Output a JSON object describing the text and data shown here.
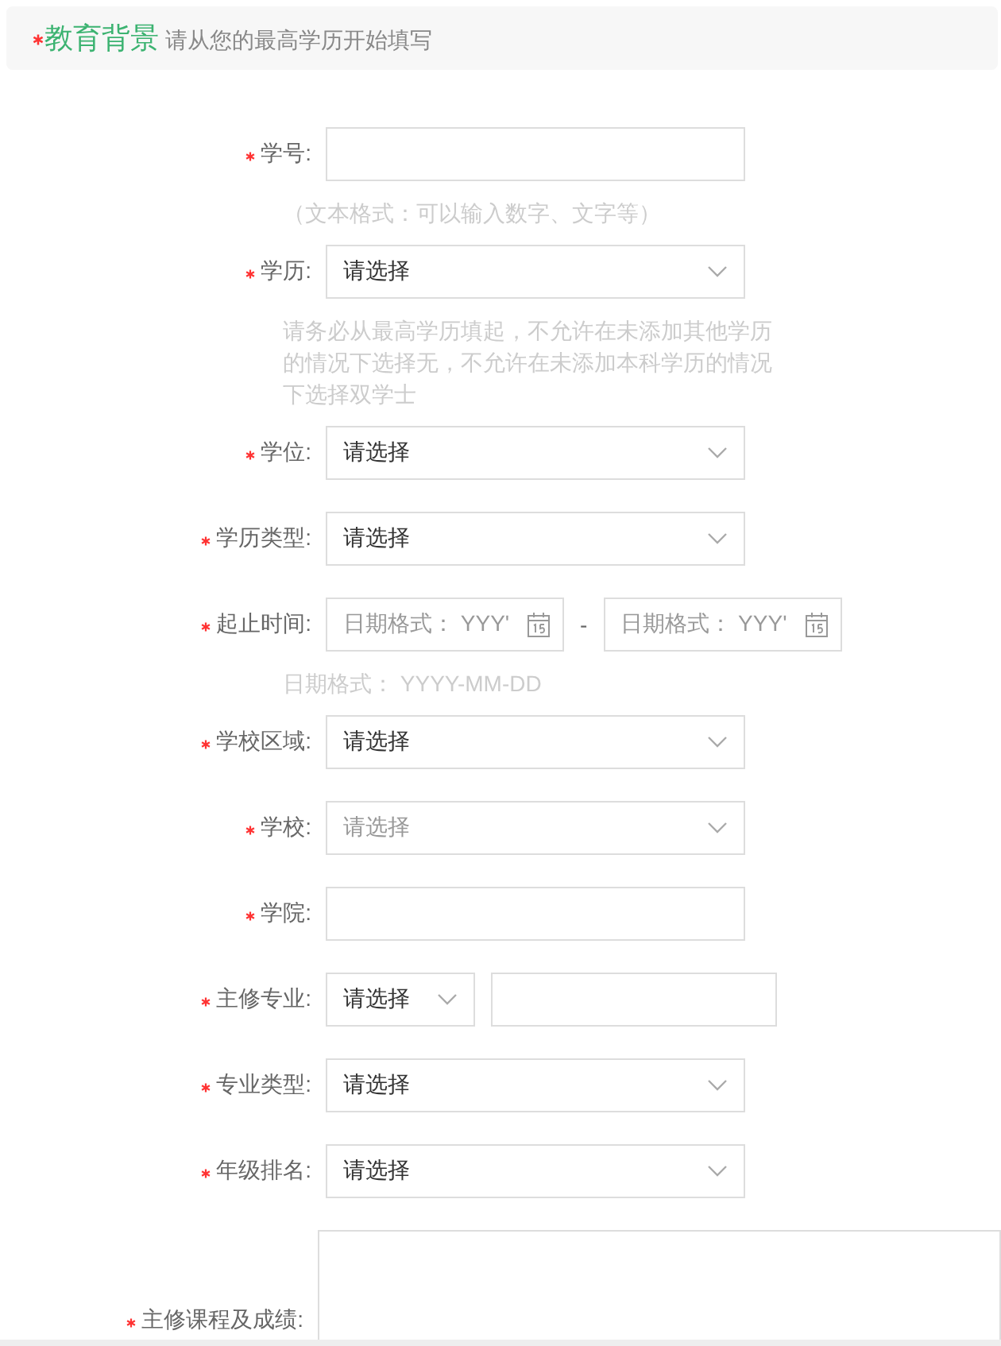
{
  "header": {
    "required": true,
    "title": "教育背景",
    "subtitle": "请从您的最高学历开始填写"
  },
  "fields": [
    {
      "kind": "text",
      "label": "学号:",
      "required": true,
      "hint": "（文本格式：可以输入数字、文字等）"
    },
    {
      "kind": "select",
      "label": "学历:",
      "required": true,
      "value": "请选择",
      "disabled": false,
      "hint": "请务必从最高学历填起，不允许在未添加其他学历的情况下选择无，不允许在未添加本科学历的情况下选择双学士"
    },
    {
      "kind": "select",
      "label": "学位:",
      "required": true,
      "value": "请选择",
      "disabled": false
    },
    {
      "kind": "select",
      "label": "学历类型:",
      "required": true,
      "value": "请选择",
      "disabled": false
    },
    {
      "kind": "daterange",
      "label": "起止时间:",
      "required": true,
      "start_placeholder": "日期格式： YYY'",
      "separator": "-",
      "end_placeholder": "日期格式： YYY'",
      "hint": "日期格式： YYYY-MM-DD"
    },
    {
      "kind": "select",
      "label": "学校区域:",
      "required": true,
      "value": "请选择",
      "disabled": false
    },
    {
      "kind": "select",
      "label": "学校:",
      "required": true,
      "value": "请选择",
      "disabled": true
    },
    {
      "kind": "text",
      "label": "学院:",
      "required": true
    },
    {
      "kind": "select-text",
      "label": "主修专业:",
      "required": true,
      "value": "请选择",
      "disabled": false
    },
    {
      "kind": "select",
      "label": "专业类型:",
      "required": true,
      "value": "请选择",
      "disabled": false
    },
    {
      "kind": "select",
      "label": "年级排名:",
      "required": true,
      "value": "请选择",
      "disabled": false
    },
    {
      "kind": "textarea",
      "label": "主修课程及成绩:",
      "required": true
    }
  ]
}
